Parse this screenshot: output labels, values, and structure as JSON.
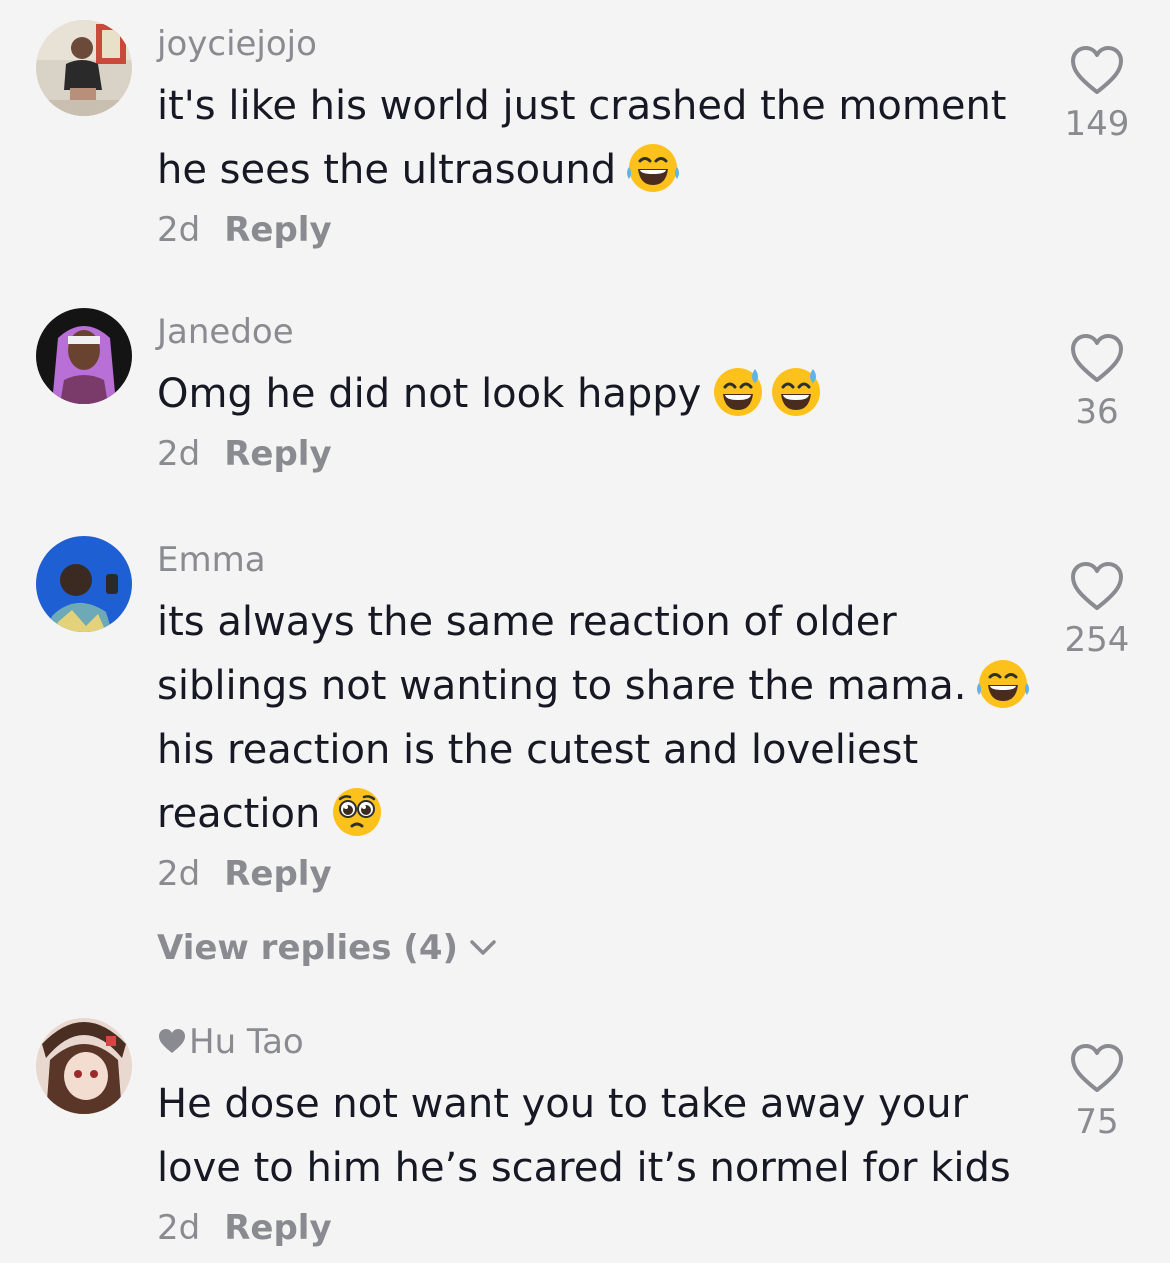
{
  "comments": [
    {
      "username": "joyciejojo",
      "lines": [
        "it's like his world just crashed the moment",
        "he sees the ultrasound"
      ],
      "time": "2d",
      "reply_label": "Reply",
      "likes": "149"
    },
    {
      "username": "Janedoe",
      "lines": [
        "Omg he did not look happy"
      ],
      "time": "2d",
      "reply_label": "Reply",
      "likes": "36"
    },
    {
      "username": "Emma",
      "lines": [
        "its always the same reaction of older",
        "siblings not wanting to share the mama.",
        "his reaction is the cutest and loveliest",
        "reaction"
      ],
      "time": "2d",
      "reply_label": "Reply",
      "view_replies": "View replies (4)",
      "likes": "254"
    },
    {
      "username": "Hu Tao",
      "lines": [
        "He dose not want you to take away your",
        "love to him he’s scared it’s normel for kids"
      ],
      "time": "2d",
      "reply_label": "Reply",
      "likes": "75"
    }
  ],
  "icons": {
    "like": "heart-outline-icon",
    "laugh_emoji": "face-with-tears-of-joy-emoji",
    "sweat_emoji": "grinning-face-with-sweat-emoji",
    "pleading_emoji": "pleading-face-emoji",
    "chevron": "chevron-down-icon"
  },
  "colors": {
    "background": "#f5f4f4",
    "text": "#161823",
    "secondary": "#8a8b91"
  }
}
